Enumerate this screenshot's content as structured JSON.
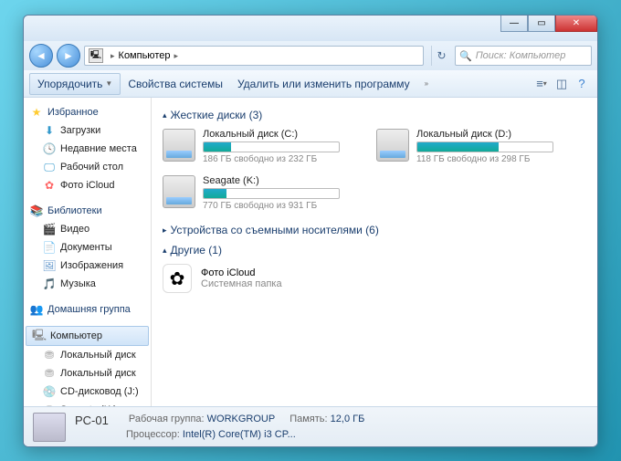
{
  "titlebar": {},
  "address": {
    "location": "Компьютер",
    "search_placeholder": "Поиск: Компьютер"
  },
  "toolbar": {
    "organize": "Упорядочить",
    "properties": "Свойства системы",
    "uninstall": "Удалить или изменить программу"
  },
  "sidebar": {
    "favorites": {
      "title": "Избранное",
      "items": [
        "Загрузки",
        "Недавние места",
        "Рабочий стол",
        "Фото iCloud"
      ]
    },
    "libraries": {
      "title": "Библиотеки",
      "items": [
        "Видео",
        "Документы",
        "Изображения",
        "Музыка"
      ]
    },
    "homegroup": {
      "title": "Домашняя группа"
    },
    "computer": {
      "title": "Компьютер",
      "items": [
        "Локальный диск",
        "Локальный диск",
        "CD-дисковод (J:)",
        "Seagate (K:)"
      ]
    }
  },
  "content": {
    "hdd_header": "Жесткие диски (3)",
    "removable_header": "Устройства со съемными носителями (6)",
    "other_header": "Другие (1)",
    "drives": [
      {
        "name": "Локальный диск (C:)",
        "free": "186 ГБ свободно из 232 ГБ",
        "fill_pct": 20
      },
      {
        "name": "Локальный диск (D:)",
        "free": "118 ГБ свободно из 298 ГБ",
        "fill_pct": 60
      },
      {
        "name": "Seagate (K:)",
        "free": "770 ГБ свободно из 931 ГБ",
        "fill_pct": 17
      }
    ],
    "other": {
      "name": "Фото iCloud",
      "type": "Системная папка"
    }
  },
  "status": {
    "pc_name": "PC-01",
    "workgroup_label": "Рабочая группа:",
    "workgroup": "WORKGROUP",
    "memory_label": "Память:",
    "memory": "12,0 ГБ",
    "cpu_label": "Процессор:",
    "cpu": "Intel(R) Core(TM) i3 CP..."
  }
}
